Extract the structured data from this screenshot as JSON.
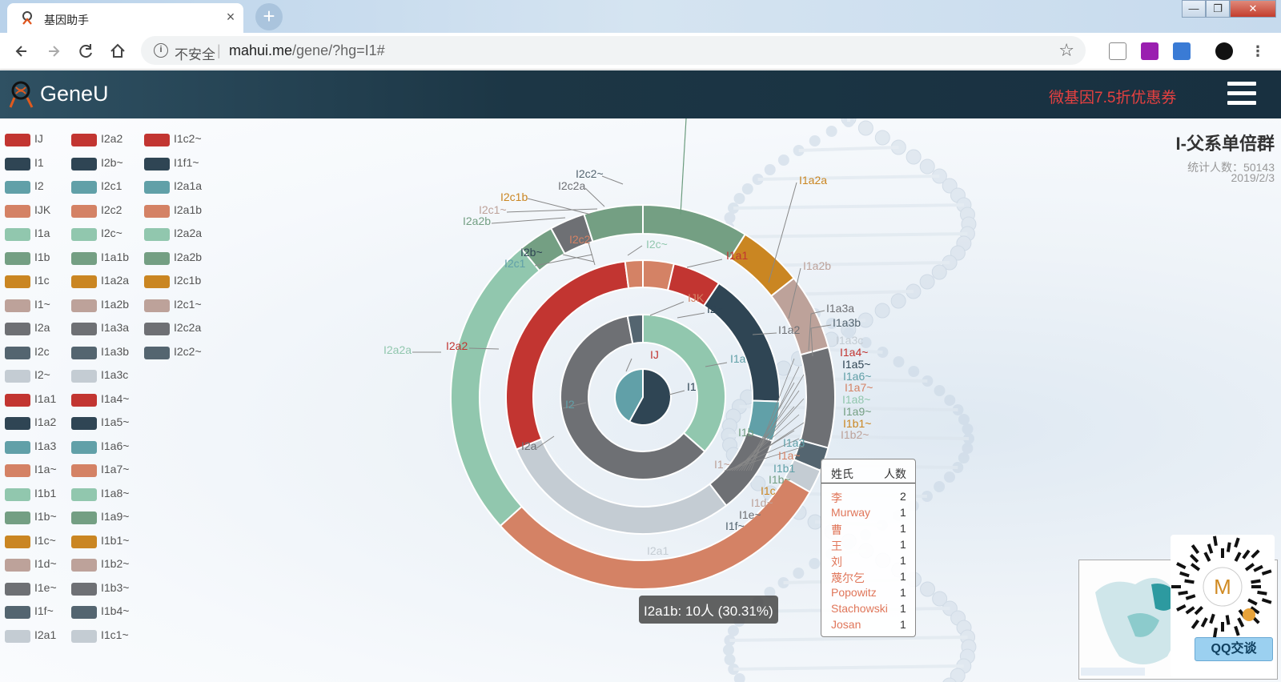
{
  "browser": {
    "tab_title": "基因助手",
    "tab_close": "×",
    "new_tab": "+",
    "insecure_label": "不安全",
    "url_host": "mahui.me",
    "url_path": "/gene/?hg=I1#",
    "win_min": "—",
    "win_max": "❐",
    "win_close": "✕"
  },
  "header": {
    "brand": "GeneU",
    "promo": "微基因7.5折优惠券"
  },
  "legend": {
    "columns": [
      [
        "IJ",
        "I1",
        "I2",
        "IJK",
        "I1a",
        "I1b",
        "I1c",
        "I1~",
        "I2a",
        "I2c",
        "I2~",
        "I1a1",
        "I1a2",
        "I1a3",
        "I1a~",
        "I1b1",
        "I1b~",
        "I1c~",
        "I1d~",
        "I1e~",
        "I1f~",
        "I2a1"
      ],
      [
        "I2a2",
        "I2b~",
        "I2c1",
        "I2c2",
        "I2c~",
        "I1a1b",
        "I1a2a",
        "I1a2b",
        "I1a3a",
        "I1a3b",
        "I1a3c",
        "I1a4~",
        "I1a5~",
        "I1a6~",
        "I1a7~",
        "I1a8~",
        "I1a9~",
        "I1b1~",
        "I1b2~",
        "I1b3~",
        "I1b4~",
        "I1c1~"
      ],
      [
        "I1c2~",
        "I1f1~",
        "I2a1a",
        "I2a1b",
        "I2a2a",
        "I2a2b",
        "I2c1b",
        "I2c1~",
        "I2c2a",
        "I2c2~"
      ]
    ],
    "palette": [
      "#c23531",
      "#2f4554",
      "#61a0a8",
      "#d48265",
      "#91c7ae",
      "#749f83",
      "#ca8622",
      "#bda29a",
      "#6e7074",
      "#546570",
      "#c4ccd3"
    ]
  },
  "chart_header": {
    "title": "I-父系单倍群",
    "count": "统计人数：50143",
    "date": "2019/2/3"
  },
  "chart_data": {
    "type": "sunburst",
    "rings": [
      [
        {
          "name": "IJ",
          "value": 0.58,
          "color": "#2f4554"
        },
        {
          "name": "",
          "value": 0.42,
          "color": "#61a0a8"
        }
      ],
      [
        {
          "name": "I1",
          "value": 0.365,
          "color": "#91c7ae"
        },
        {
          "name": "I2",
          "value": 0.605,
          "color": "#6e7074"
        },
        {
          "name": "",
          "value": 0.03,
          "color": "#546570"
        }
      ],
      [
        {
          "name": "IJK",
          "value": 0.035,
          "color": "#d48265"
        },
        {
          "name": "I2~",
          "value": 0.055,
          "color": "#c23531"
        },
        {
          "name": "I1a",
          "value": 0.155,
          "color": "#2f4554"
        },
        {
          "name": "",
          "value": 0.045,
          "color": "#61a0a8"
        },
        {
          "name": "",
          "value": 0.09,
          "color": "#6e7074"
        },
        {
          "name": "I2a1",
          "value": 0.28,
          "color": "#c4ccd3"
        },
        {
          "name": "I2a2",
          "value": 0.28,
          "color": "#c23531"
        },
        {
          "name": "I2c2",
          "value": 0.02,
          "color": "#d48265"
        }
      ],
      [
        {
          "name": "I1a1",
          "value": 0.09,
          "color": "#749f83"
        },
        {
          "name": "I1a2a",
          "value": 0.055,
          "color": "#ca8622"
        },
        {
          "name": "I1a2b",
          "value": 0.065,
          "color": "#bda29a"
        },
        {
          "name": "I1a3",
          "value": 0.085,
          "color": "#6e7074"
        },
        {
          "name": "I1b1",
          "value": 0.02,
          "color": "#546570"
        },
        {
          "name": "",
          "value": 0.02,
          "color": "#c4ccd3"
        },
        {
          "name": "I2a1b",
          "value": 0.3031,
          "color": "#d48265"
        },
        {
          "name": "I2a2a",
          "value": 0.2599,
          "color": "#91c7ae"
        },
        {
          "name": "I2a2b",
          "value": 0.03,
          "color": "#749f83"
        },
        {
          "name": "I2c2a",
          "value": 0.03,
          "color": "#6e7074"
        },
        {
          "name": "",
          "value": 0.05,
          "color": "#749f83"
        }
      ]
    ],
    "outer_labels": [
      {
        "text": "IJ",
        "color": "#c23531"
      },
      {
        "text": "I1",
        "color": "#2f4554"
      },
      {
        "text": "I2",
        "color": "#61a0a8"
      },
      {
        "text": "I2a",
        "color": "#6e7074"
      },
      {
        "text": "I1a",
        "color": "#61a0a8"
      },
      {
        "text": "IJK",
        "color": "#d48265"
      },
      {
        "text": "I2~",
        "color": "#2f4554"
      },
      {
        "text": "I2b~",
        "color": "#2f4554"
      },
      {
        "text": "I2c1",
        "color": "#61a0a8"
      },
      {
        "text": "I2c2",
        "color": "#d48265"
      },
      {
        "text": "I2c~",
        "color": "#91c7ae"
      },
      {
        "text": "I1a1",
        "color": "#c23531"
      },
      {
        "text": "I1a2",
        "color": "#6e7074"
      },
      {
        "text": "I1a2a",
        "color": "#ca8622"
      },
      {
        "text": "I1a2b",
        "color": "#bda29a"
      },
      {
        "text": "I2c2~",
        "color": "#546570"
      },
      {
        "text": "I2c2a",
        "color": "#6e7074"
      },
      {
        "text": "I2c1b",
        "color": "#ca8622"
      },
      {
        "text": "I2c1~",
        "color": "#bda29a"
      },
      {
        "text": "I2a2b",
        "color": "#749f83"
      },
      {
        "text": "I2a2",
        "color": "#c23531"
      },
      {
        "text": "I2a2a",
        "color": "#91c7ae"
      },
      {
        "text": "I1a3a",
        "color": "#6e7074"
      },
      {
        "text": "I1a3b",
        "color": "#546570"
      },
      {
        "text": "I1a3c",
        "color": "#c4ccd3"
      },
      {
        "text": "I1a4~",
        "color": "#c23531"
      },
      {
        "text": "I1a5~",
        "color": "#2f4554"
      },
      {
        "text": "I1a6~",
        "color": "#61a0a8"
      },
      {
        "text": "I1a7~",
        "color": "#d48265"
      },
      {
        "text": "I1a8~",
        "color": "#91c7ae"
      },
      {
        "text": "I1a9~",
        "color": "#749f83"
      },
      {
        "text": "I1b1~",
        "color": "#ca8622"
      },
      {
        "text": "I1b2~",
        "color": "#bda29a"
      },
      {
        "text": "I1a3",
        "color": "#61a0a8"
      },
      {
        "text": "I1a~",
        "color": "#d48265"
      },
      {
        "text": "I1b1",
        "color": "#61a0a8"
      },
      {
        "text": "I1b~",
        "color": "#749f83"
      },
      {
        "text": "I1c",
        "color": "#ca8622"
      },
      {
        "text": "I1d~",
        "color": "#bda29a"
      },
      {
        "text": "I1e~",
        "color": "#6e7074"
      },
      {
        "text": "I1f~",
        "color": "#546570"
      },
      {
        "text": "I2a1",
        "color": "#c4ccd3"
      },
      {
        "text": "I1~",
        "color": "#bda29a"
      },
      {
        "text": "I1b",
        "color": "#749f83"
      }
    ]
  },
  "surname_table": {
    "header_name": "姓氏",
    "header_count": "人数",
    "rows": [
      {
        "name": "李",
        "count": "2"
      },
      {
        "name": "Murway",
        "count": "1"
      },
      {
        "name": "曹",
        "count": "1"
      },
      {
        "name": "王",
        "count": "1"
      },
      {
        "name": "刘",
        "count": "1"
      },
      {
        "name": "蔑尔乞",
        "count": "1"
      },
      {
        "name": "Popowitz",
        "count": "1"
      },
      {
        "name": "Stachowski",
        "count": "1"
      },
      {
        "name": "Josan",
        "count": "1"
      }
    ]
  },
  "slice_tooltip": "I2a1b: 10人 (30.31%)",
  "widgets": {
    "qr_letter": "M",
    "qq_button": "QQ交谈"
  }
}
